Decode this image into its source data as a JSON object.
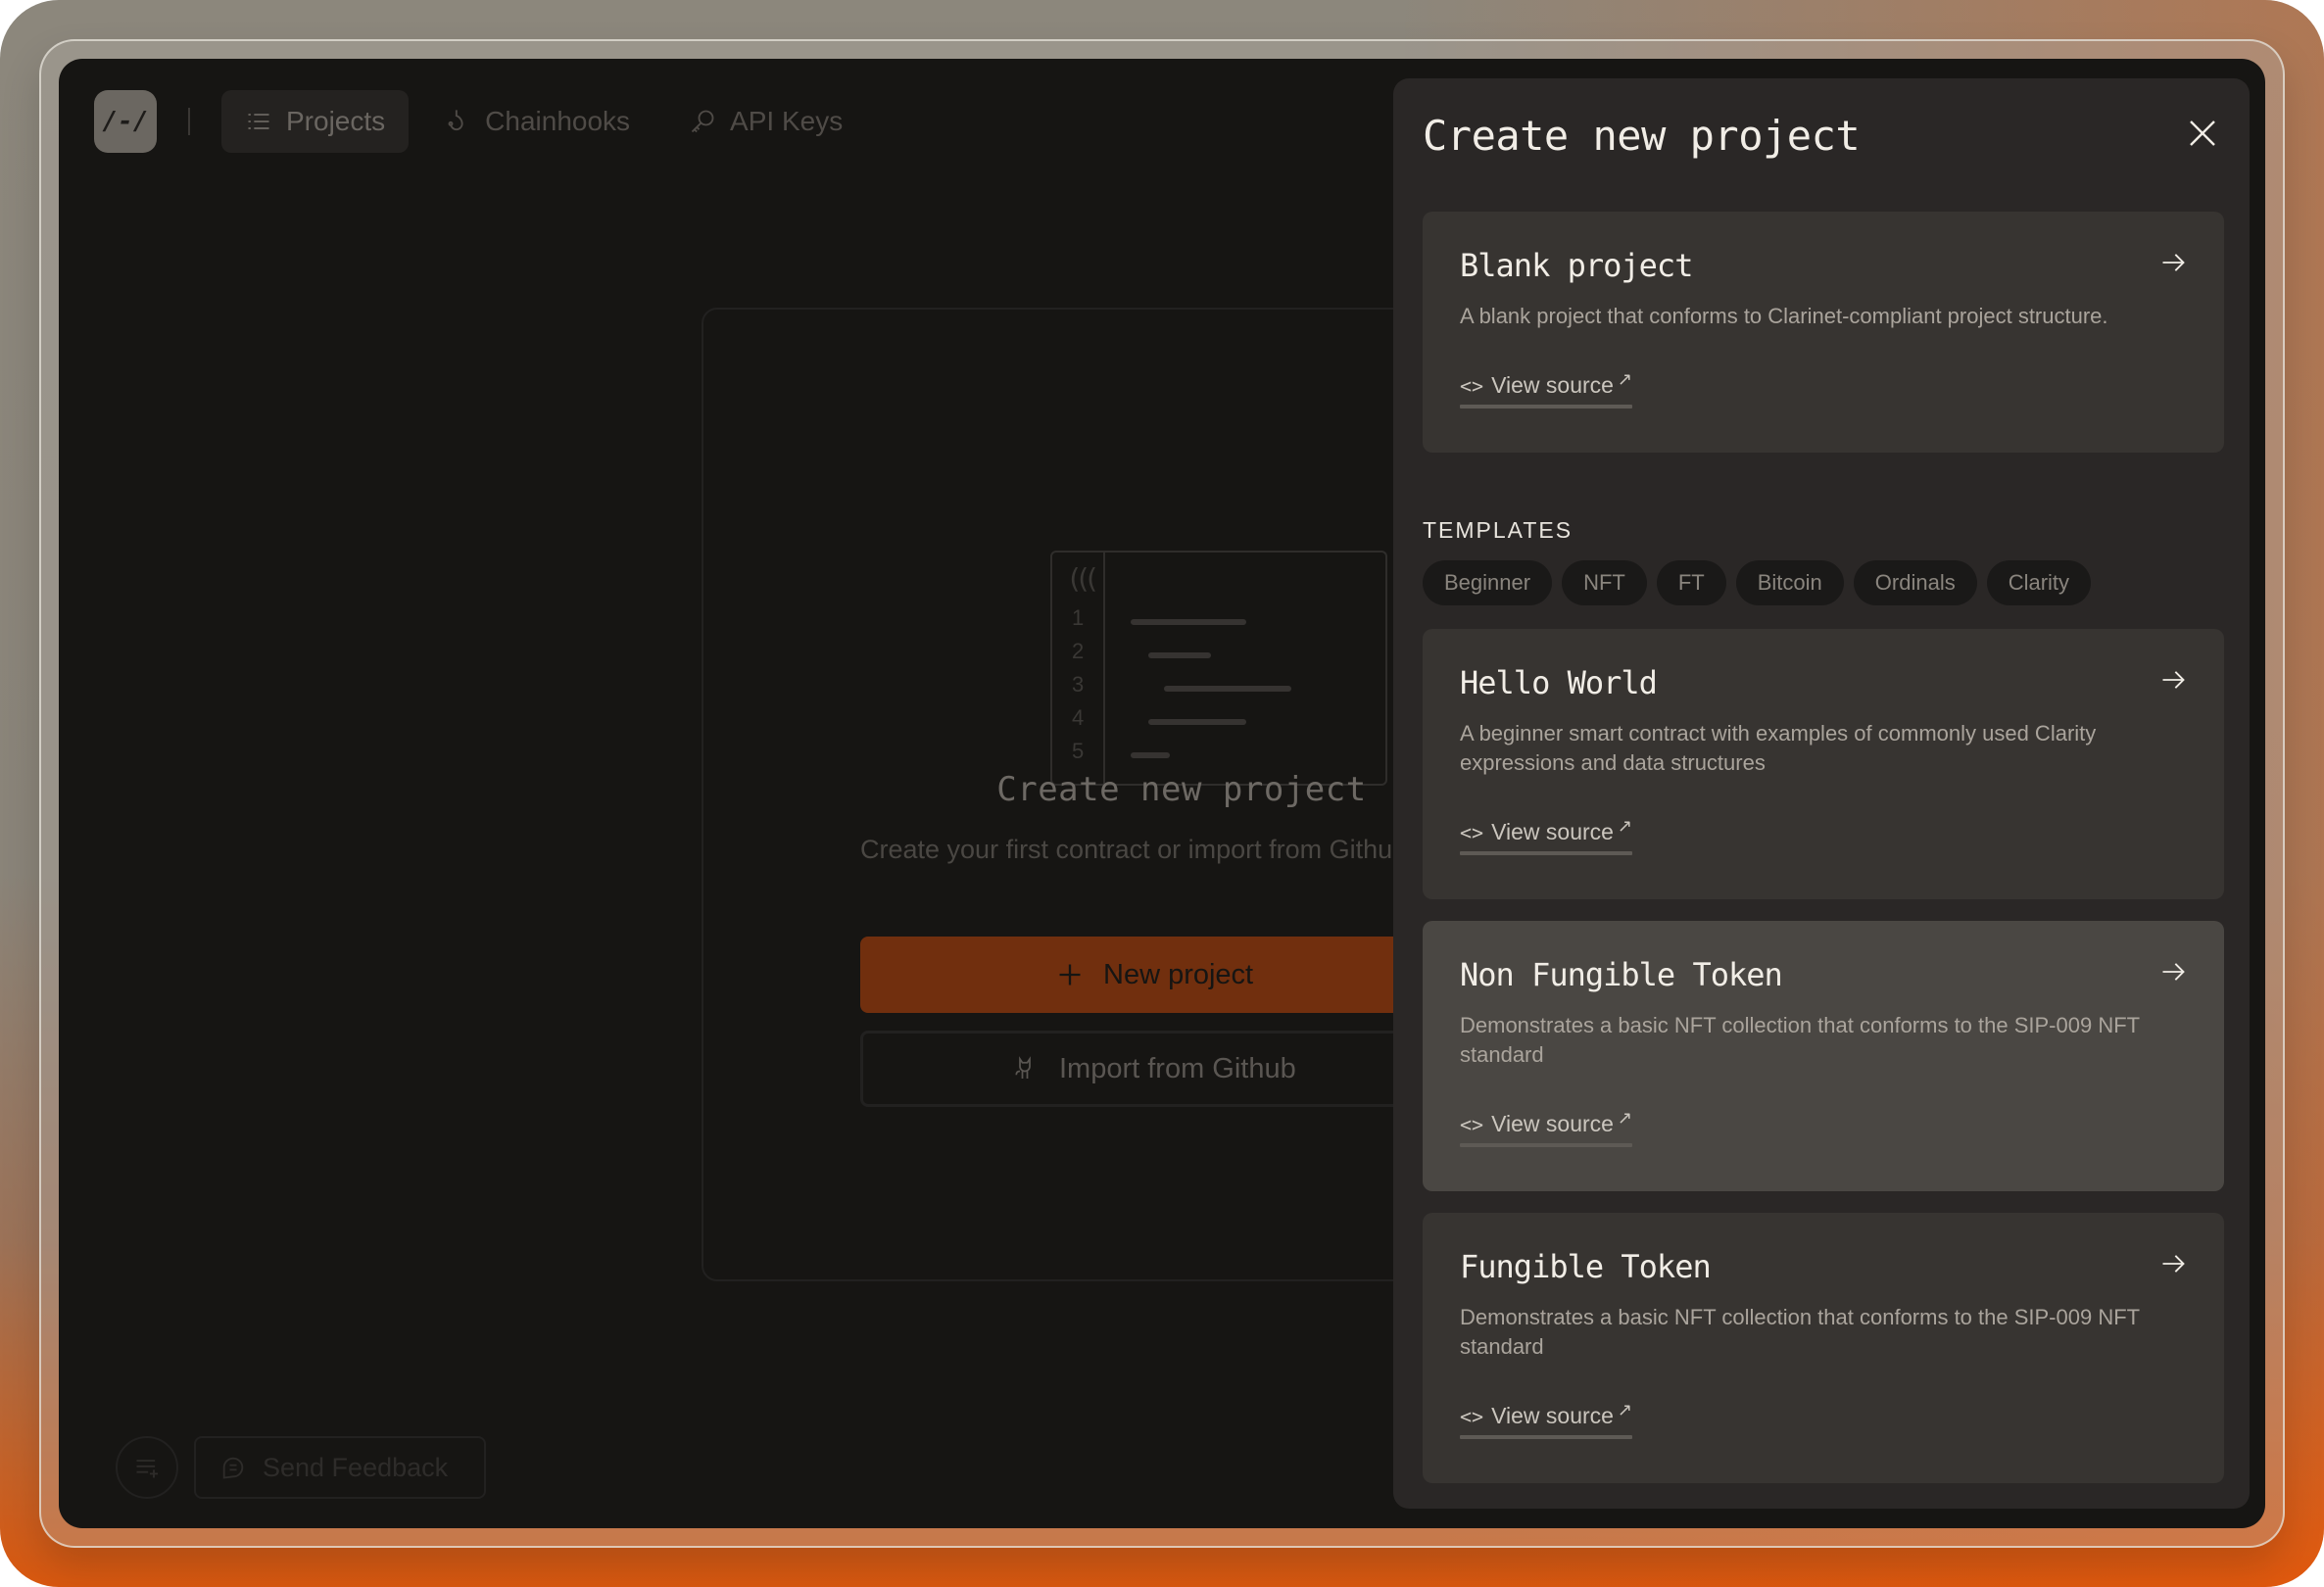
{
  "nav": {
    "logo_text": "/-/",
    "items": [
      {
        "label": "Projects",
        "icon": "list-icon",
        "active": true
      },
      {
        "label": "Chainhooks",
        "icon": "hook-icon",
        "active": false
      },
      {
        "label": "API Keys",
        "icon": "key-icon",
        "active": false
      }
    ]
  },
  "empty_state": {
    "illustration": {
      "paren_glyph": "(((",
      "line_numbers": [
        "1",
        "2",
        "3",
        "4",
        "5"
      ]
    },
    "title": "Create new project",
    "subtitle": "Create your first contract or import from Github",
    "new_project_label": "New project",
    "import_label": "Import from Github"
  },
  "footer": {
    "send_feedback_label": "Send Feedback"
  },
  "panel": {
    "title": "Create new project",
    "close_icon": "close-icon",
    "blank_project": {
      "title": "Blank project",
      "description": "A blank project that conforms to Clarinet-compliant project structure.",
      "link_label": "View source"
    },
    "templates_label": "TEMPLATES",
    "filters": [
      "Beginner",
      "NFT",
      "FT",
      "Bitcoin",
      "Ordinals",
      "Clarity"
    ],
    "templates": [
      {
        "title": "Hello World",
        "description": "A beginner smart contract with examples of commonly used Clarity expressions and data structures",
        "link_label": "View source",
        "hovered": false
      },
      {
        "title": "Non Fungible Token",
        "description": "Demonstrates a basic NFT collection that conforms to the SIP-009 NFT standard",
        "link_label": "View source",
        "hovered": true
      },
      {
        "title": "Fungible Token",
        "description": "Demonstrates a basic NFT collection that conforms to the SIP-009 NFT standard",
        "link_label": "View source",
        "hovered": false
      }
    ]
  },
  "colors": {
    "accent": "#712f0e",
    "window_bg": "#161513",
    "panel_bg": "#2a2726",
    "card_bg": "#373431",
    "card_hover_bg": "#4a4743"
  }
}
